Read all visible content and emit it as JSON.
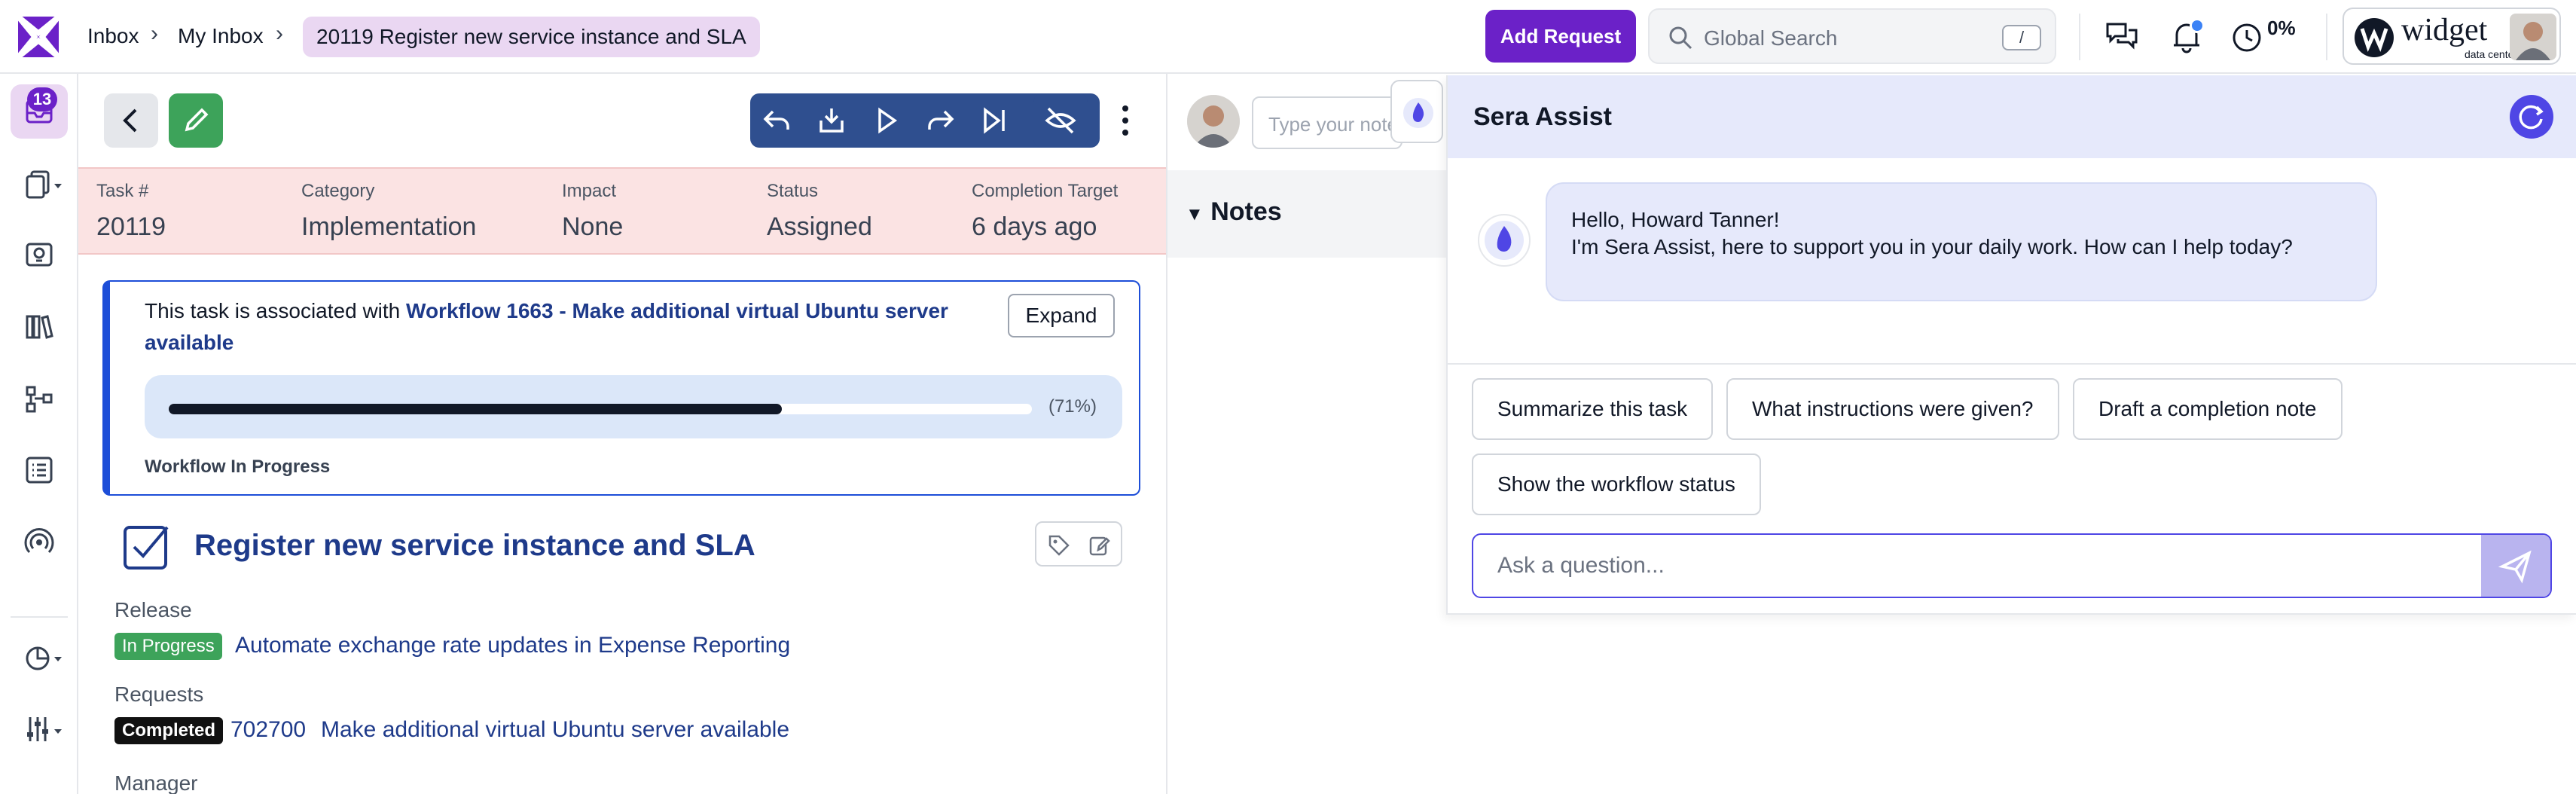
{
  "breadcrumb": {
    "items": [
      "Inbox",
      "My Inbox"
    ],
    "current": "20119  Register new service instance and SLA"
  },
  "header": {
    "add_request_label": "Add Request",
    "search_placeholder": "Global Search",
    "search_shortcut": "/",
    "timer_percent": "0%",
    "brand_name": "widget",
    "brand_subtitle": "data center"
  },
  "sidebar": {
    "inbox_badge": "13"
  },
  "task_meta": [
    {
      "label": "Task #",
      "value": "20119"
    },
    {
      "label": "Category",
      "value": "Implementation"
    },
    {
      "label": "Impact",
      "value": "None"
    },
    {
      "label": "Status",
      "value": "Assigned"
    },
    {
      "label": "Completion Target",
      "value": "6 days ago"
    }
  ],
  "workflow": {
    "prefix": "This task is associated with ",
    "link": "Workflow 1663 - Make additional virtual Ubuntu server available",
    "expand_label": "Expand",
    "progress": 0.71,
    "progress_label": "(71%)",
    "status": "Workflow In Progress"
  },
  "task": {
    "title": "Register new service instance and SLA",
    "release_label": "Release",
    "release_status": "In Progress",
    "release_link": "Automate exchange rate updates in Expense Reporting",
    "requests_label": "Requests",
    "request_status": "Completed",
    "request_id": "702700",
    "request_link": "Make additional virtual Ubuntu server available",
    "manager_label": "Manager"
  },
  "notes": {
    "input_placeholder": "Type your note",
    "title": "Notes"
  },
  "sera": {
    "title": "Sera Assist",
    "greeting_line1": "Hello, Howard Tanner!",
    "greeting_line2": "I'm Sera Assist, here to support you in your daily work. How can I help today?",
    "suggestions": [
      "Summarize this task",
      "What instructions were given?",
      "Draft a completion note",
      "Show the workflow status"
    ],
    "input_placeholder": "Ask a question..."
  },
  "colors": {
    "brand_purple": "#6b21c8",
    "action_blue": "#2f4f8f",
    "success_green": "#3da35a",
    "link_blue": "#1e3a8a",
    "sera_indigo": "#4f46e5"
  }
}
